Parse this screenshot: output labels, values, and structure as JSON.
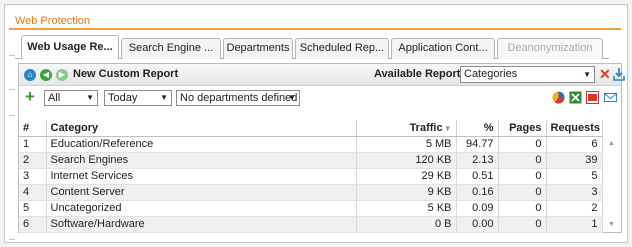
{
  "panel": {
    "title": "Web Protection"
  },
  "tabs": [
    {
      "label": "Web Usage Re...",
      "state": "active"
    },
    {
      "label": "Search Engine ...",
      "state": "normal"
    },
    {
      "label": "Departments",
      "state": "normal"
    },
    {
      "label": "Scheduled Rep...",
      "state": "normal"
    },
    {
      "label": "Application Cont...",
      "state": "normal"
    },
    {
      "label": "Deanonymization",
      "state": "disabled"
    }
  ],
  "report": {
    "title": "New Custom Report",
    "available_label": "Available Reports:",
    "available_value": "Categories"
  },
  "filters": {
    "scope": "All",
    "period": "Today",
    "departments": "No departments defined"
  },
  "table": {
    "columns": {
      "num": "#",
      "category": "Category",
      "traffic": "Traffic",
      "percent": "%",
      "pages": "Pages",
      "requests": "Requests"
    },
    "sort_indicator": "▼",
    "rows": [
      {
        "num": "1",
        "category": "Education/Reference",
        "traffic": "5 MB",
        "percent": "94.77",
        "pages": "0",
        "requests": "6"
      },
      {
        "num": "2",
        "category": "Search Engines",
        "traffic": "120 KB",
        "percent": "2.13",
        "pages": "0",
        "requests": "39"
      },
      {
        "num": "3",
        "category": "Internet Services",
        "traffic": "29 KB",
        "percent": "0.51",
        "pages": "0",
        "requests": "5"
      },
      {
        "num": "4",
        "category": "Content Server",
        "traffic": "9 KB",
        "percent": "0.16",
        "pages": "0",
        "requests": "3"
      },
      {
        "num": "5",
        "category": "Uncategorized",
        "traffic": "5 KB",
        "percent": "0.09",
        "pages": "0",
        "requests": "2"
      },
      {
        "num": "6",
        "category": "Software/Hardware",
        "traffic": "0 B",
        "percent": "0.00",
        "pages": "0",
        "requests": "1"
      }
    ]
  },
  "icons": {
    "home": "home-icon",
    "back": "back-icon",
    "forward": "forward-icon",
    "add": "add-icon",
    "chart": "pie-chart-icon",
    "excel": "excel-icon",
    "pdf": "pdf-icon",
    "mail": "email-icon",
    "close": "close-icon",
    "download": "download-icon"
  },
  "colors": {
    "accent": "#e07a1f",
    "accent_line": "#f0a040",
    "home_icon": "#2a86c8",
    "nav_icon": "#3aa63a",
    "add_icon": "#3e9a2a",
    "close_icon": "#e23b2e",
    "download_icon": "#2a86c8"
  }
}
